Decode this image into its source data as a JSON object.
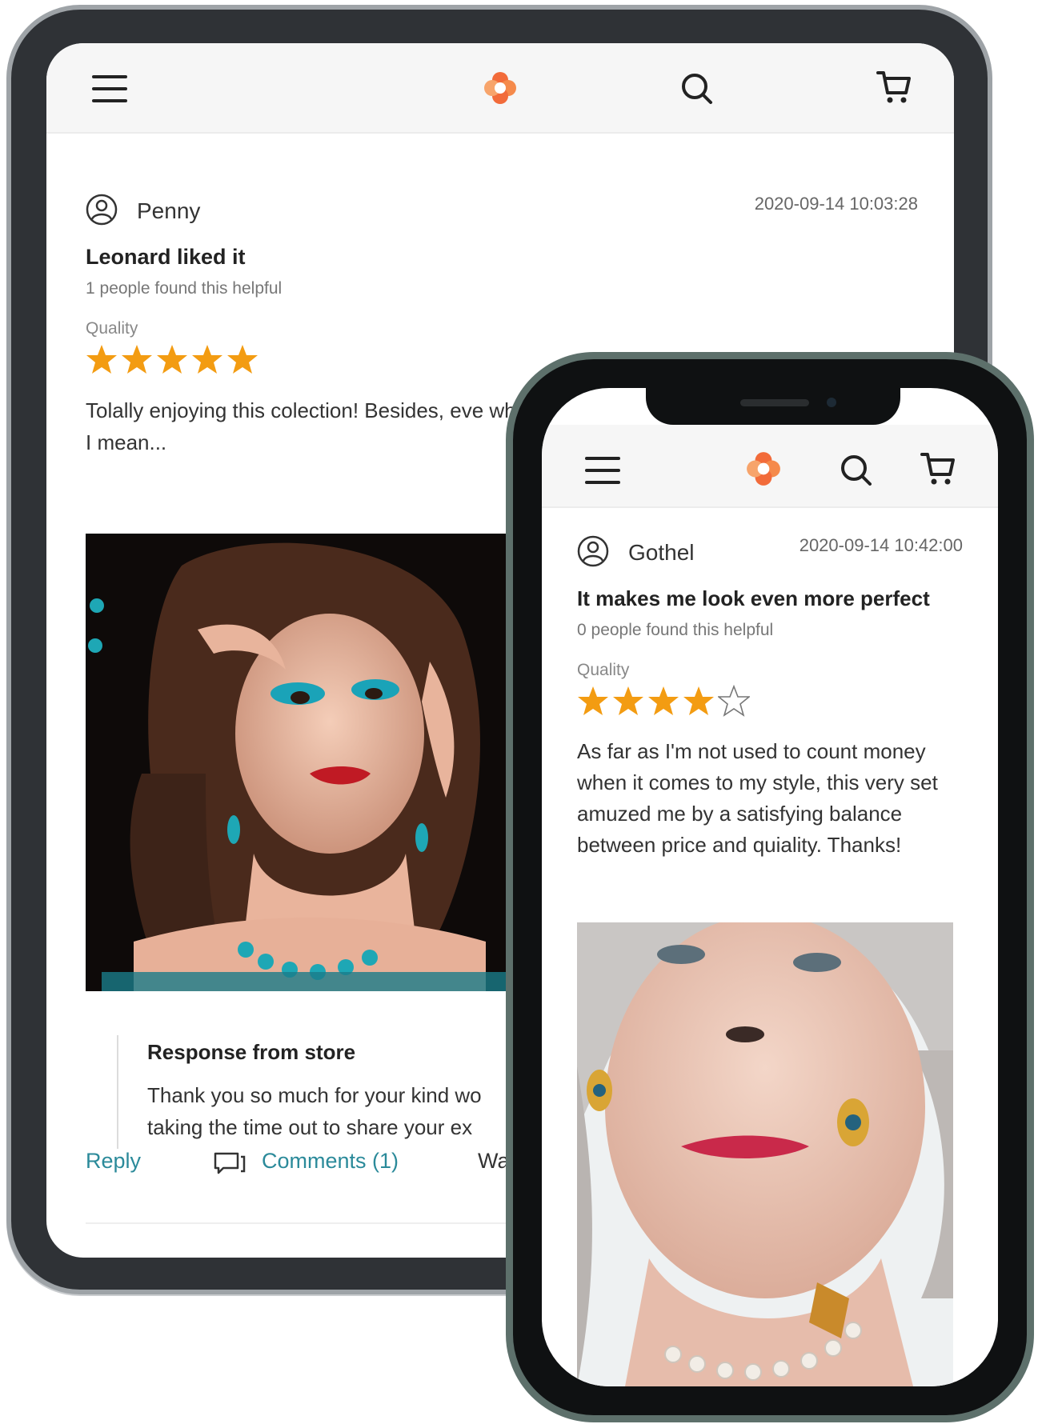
{
  "tablet": {
    "header": {
      "menu_icon": "hamburger-icon",
      "logo_icon": "flower-logo-icon",
      "search_icon": "search-icon",
      "cart_icon": "cart-icon"
    },
    "review": {
      "username": "Penny",
      "date": "2020-09-14 10:03:28",
      "title": "Leonard liked it",
      "helpful": "1 people found this helpful",
      "quality_label": "Quality",
      "rating": 5,
      "body": "Tolally enjoying this colection! Besides, eve what I mean...",
      "response": {
        "title": "Response from store",
        "body": "Thank you so much for your kind wo taking the time out to share your ex"
      },
      "actions": {
        "reply": "Reply",
        "comments": "Comments (1)",
        "more": "Wa"
      }
    }
  },
  "phone": {
    "header": {
      "menu_icon": "hamburger-icon",
      "logo_icon": "flower-logo-icon",
      "search_icon": "search-icon",
      "cart_icon": "cart-icon"
    },
    "review": {
      "username": "Gothel",
      "date": "2020-09-14 10:42:00",
      "title": "It makes me look even more perfect",
      "helpful": "0 people found this helpful",
      "quality_label": "Quality",
      "rating": 4,
      "body": "As far as I'm not used to count money when it comes to my style, this very set amuzed me by a satisfying balance between price and quiality. Thanks!"
    }
  },
  "colors": {
    "accent": "#2b8a9a",
    "star": "#f39c12",
    "logo_orange": "#f26b3a",
    "logo_pink": "#f7a46b"
  }
}
